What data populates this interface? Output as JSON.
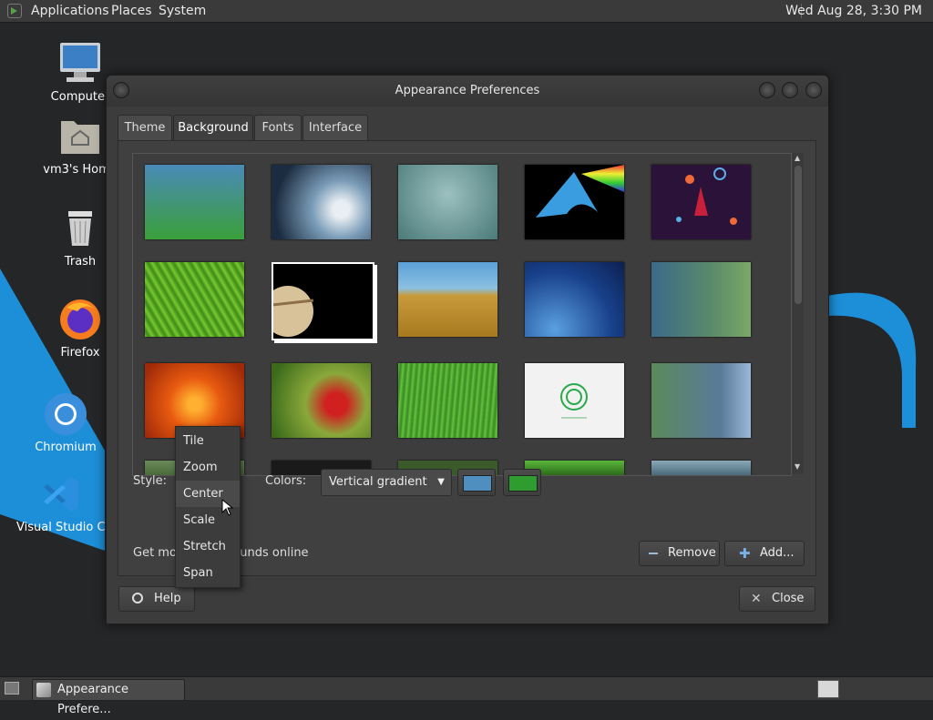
{
  "panel_top": {
    "menus": [
      "Applications",
      "Places",
      "System"
    ],
    "clock": "Wed Aug 28,  3:30 PM"
  },
  "desktop": {
    "icons": [
      {
        "label": "Computer",
        "icon": "computer-icon"
      },
      {
        "label": "vm3's Home",
        "icon": "home-folder-icon"
      },
      {
        "label": "Trash",
        "icon": "trash-icon"
      },
      {
        "label": "Firefox",
        "icon": "firefox-icon"
      },
      {
        "label": "Chromium",
        "icon": "chromium-icon"
      },
      {
        "label": "Visual Studio Code",
        "icon": "vscode-icon"
      }
    ]
  },
  "window": {
    "title": "Appearance Preferences",
    "tabs": [
      "Theme",
      "Background",
      "Fonts",
      "Interface"
    ],
    "active_tab": "Background",
    "style_label": "Style:",
    "colors_label": "Colors:",
    "colors_value": "Vertical gradient",
    "color1": "#4f8fc0",
    "color2": "#2e9c2e",
    "get_more_text": "Get more backgrounds online",
    "remove_label": "Remove",
    "add_label": "Add...",
    "help_label": "Help",
    "close_label": "Close",
    "style_dropdown": {
      "options": [
        "Tile",
        "Zoom",
        "Center",
        "Scale",
        "Stretch",
        "Span"
      ],
      "hovered": "Center"
    }
  },
  "taskbar": {
    "window_button": "Appearance Prefere..."
  }
}
